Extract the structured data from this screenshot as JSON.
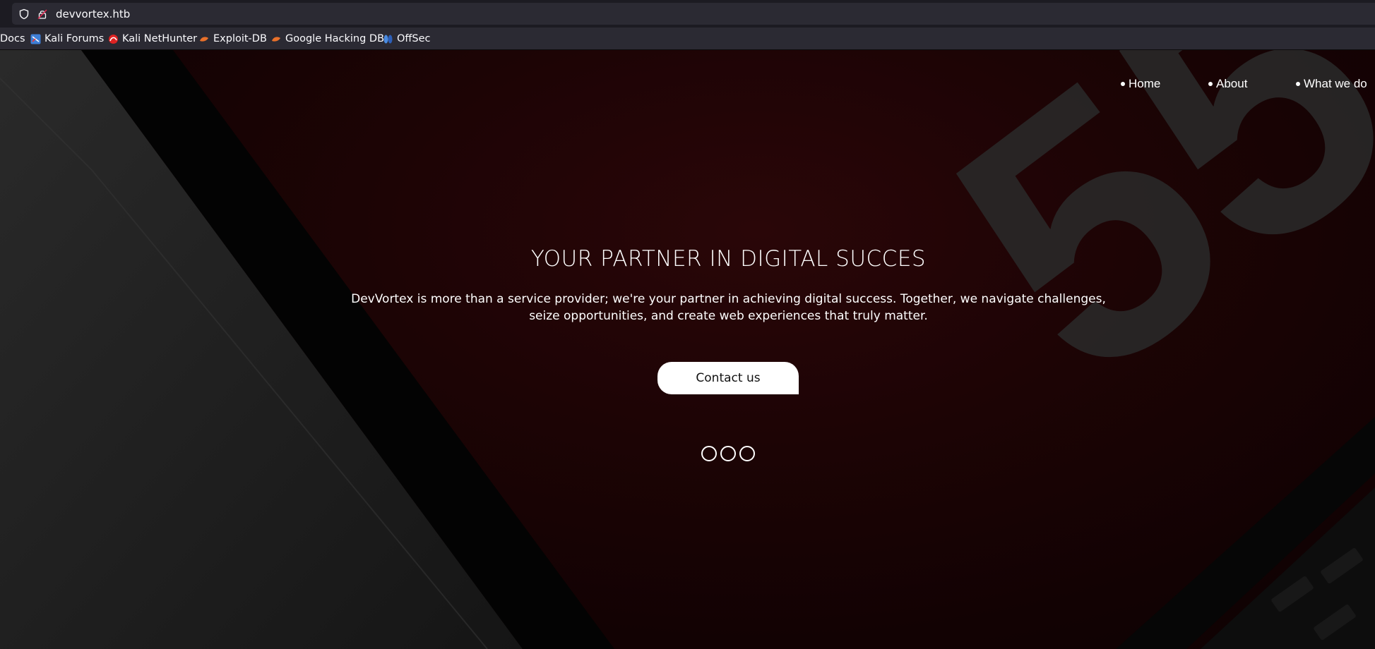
{
  "browser": {
    "url": "devvortex.htb",
    "bookmarks": [
      {
        "label": "Docs",
        "icon": "docs-icon"
      },
      {
        "label": "Kali Forums",
        "icon": "kali-forums-icon"
      },
      {
        "label": "Kali NetHunter",
        "icon": "kali-nethunter-icon"
      },
      {
        "label": "Exploit-DB",
        "icon": "exploit-db-icon"
      },
      {
        "label": "Google Hacking DB",
        "icon": "google-hacking-db-icon"
      },
      {
        "label": "OffSec",
        "icon": "offsec-icon"
      }
    ]
  },
  "nav": {
    "items": [
      {
        "label": "Home"
      },
      {
        "label": "About"
      },
      {
        "label": "What we do"
      }
    ]
  },
  "hero": {
    "headline": "YOUR PARTNER IN DIGITAL SUCCES",
    "subtext": "DevVortex is more than a service provider; we're your partner in achieving digital success. Together, we navigate challenges, seize opportunities, and create web experiences that truly matter.",
    "cta_label": "Contact us",
    "slide_count": 3,
    "background_digits": "55"
  },
  "colors": {
    "accent_red": "#2a0608",
    "cta_bg": "#ffffff",
    "chrome_bg": "#2b2a33"
  }
}
